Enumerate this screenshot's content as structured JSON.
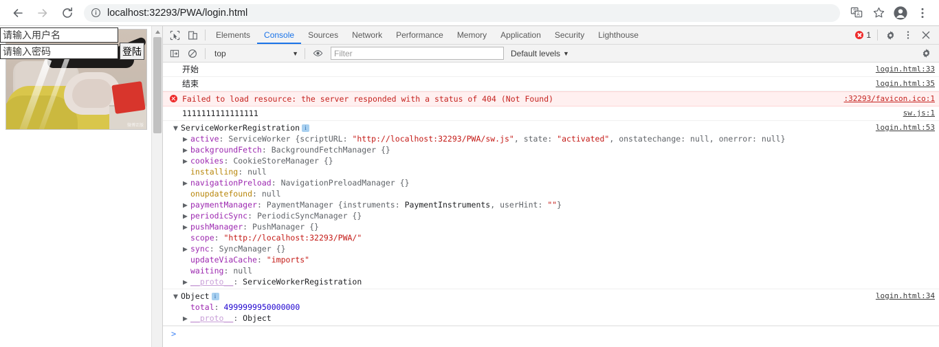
{
  "browser": {
    "back_label": "Back",
    "forward_label": "Forward",
    "reload_label": "Reload",
    "url": "localhost:32293/PWA/login.html",
    "site_info_label": "View site information",
    "translate_label": "Translate this page",
    "bookmark_label": "Bookmark this tab",
    "profile_label": "Profile",
    "menu_label": "Customize and control Google Chrome"
  },
  "page": {
    "username_placeholder": "请输入用户名",
    "username_value": "",
    "password_placeholder": "请输入密码",
    "password_value": "",
    "login_button": "登陆",
    "image_watermark": "微博正版"
  },
  "devtools": {
    "inspect_label": "Inspect element",
    "device_label": "Toggle device toolbar",
    "tabs": [
      {
        "label": "Elements",
        "active": false
      },
      {
        "label": "Console",
        "active": true
      },
      {
        "label": "Sources",
        "active": false
      },
      {
        "label": "Network",
        "active": false
      },
      {
        "label": "Performance",
        "active": false
      },
      {
        "label": "Memory",
        "active": false
      },
      {
        "label": "Application",
        "active": false
      },
      {
        "label": "Security",
        "active": false
      },
      {
        "label": "Lighthouse",
        "active": false
      }
    ],
    "error_count": "1",
    "settings_label": "Settings",
    "more_label": "More options",
    "close_label": "Close DevTools",
    "toolbar": {
      "sidebar_label": "Show console sidebar",
      "clear_label": "Clear console",
      "context": "top",
      "context_caret": "▼",
      "eye_label": "Create live expression",
      "filter_placeholder": "Filter",
      "filter_value": "",
      "levels": "Default levels",
      "levels_caret": "▼",
      "gear_label": "Console settings"
    },
    "prompt_caret": ">"
  },
  "console": {
    "messages": [
      {
        "kind": "log-cjk",
        "text": "开始",
        "source": "login.html:33"
      },
      {
        "kind": "log-cjk",
        "text": "结束",
        "source": "login.html:35"
      },
      {
        "kind": "error",
        "text": "Failed to load resource: the server responded with a status of 404 (Not Found)",
        "source": ":32293/favicon.ico:1"
      },
      {
        "kind": "log",
        "text": "1111111111111111",
        "source": "sw.js:1"
      }
    ],
    "swr_group": {
      "title": "ServiceWorkerRegistration",
      "info_badge": "i",
      "source": "login.html:53",
      "expanded_caret": "▼",
      "rows": [
        {
          "caret": "▶",
          "key": "active",
          "sep": ": ",
          "cls": "ServiceWorker ",
          "open": "{",
          "inner": "scriptURL: \"http://localhost:32293/PWA/sw.js\", state: \"activated\", onstatechange: null, onerror: null}"
        },
        {
          "caret": "▶",
          "key": "backgroundFetch",
          "sep": ": ",
          "value": "BackgroundFetchManager {}"
        },
        {
          "caret": "▶",
          "key": "cookies",
          "sep": ": ",
          "value": "CookieStoreManager {}"
        },
        {
          "caret": "",
          "key": "installing",
          "sep": ": ",
          "value": "null"
        },
        {
          "caret": "▶",
          "key": "navigationPreload",
          "sep": ": ",
          "value": "NavigationPreloadManager {}"
        },
        {
          "caret": "",
          "key": "onupdatefound",
          "sep": ": ",
          "value": "null"
        },
        {
          "caret": "▶",
          "key": "paymentManager",
          "sep": ": ",
          "value": "PaymentManager {instruments: PaymentInstruments, userHint: \"\"}"
        },
        {
          "caret": "▶",
          "key": "periodicSync",
          "sep": ": ",
          "value": "PeriodicSyncManager {}"
        },
        {
          "caret": "▶",
          "key": "pushManager",
          "sep": ": ",
          "value": "PushManager {}"
        },
        {
          "caret": "",
          "key": "scope",
          "sep": ": ",
          "value": "\"http://localhost:32293/PWA/\""
        },
        {
          "caret": "▶",
          "key": "sync",
          "sep": ": ",
          "value": "SyncManager {}"
        },
        {
          "caret": "",
          "key": "updateViaCache",
          "sep": ": ",
          "value": "\"imports\""
        },
        {
          "caret": "",
          "key": "waiting",
          "sep": ": ",
          "value": "null"
        },
        {
          "caret": "▶",
          "key": "__proto__",
          "sep": ": ",
          "value": "ServiceWorkerRegistration"
        }
      ]
    },
    "object_group": {
      "title": "Object",
      "info_badge": "i",
      "source": "login.html:34",
      "expanded_caret": "▼",
      "total_key": "total",
      "total_value": "4999999950000000",
      "proto_key": "__proto__",
      "proto_value": "Object",
      "proto_caret": "▶"
    }
  }
}
